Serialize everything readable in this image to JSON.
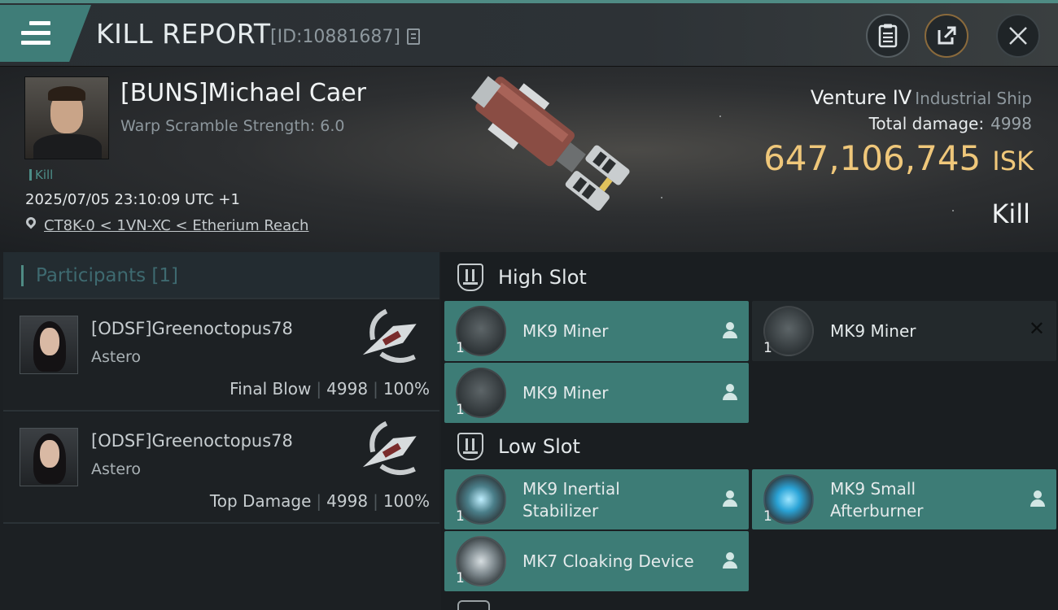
{
  "header": {
    "title": "KILL REPORT",
    "report_id": "[ID:10881687]"
  },
  "victim": {
    "name": "[BUNS]Michael Caer",
    "warp_scramble": "Warp Scramble Strength: 6.0",
    "tag": "Kill",
    "date": "2025/07/05 23:10:09 UTC +1",
    "location": "CT8K-0 < 1VN-XC < Etherium Reach"
  },
  "ship": {
    "name": "Venture IV",
    "class": "Industrial Ship",
    "total_damage_label": "Total damage:",
    "total_damage": "4998",
    "isk_value": "647,106,745",
    "isk_unit": "ISK",
    "result": "Kill"
  },
  "participants": {
    "label": "Participants [1]",
    "items": [
      {
        "name": "[ODSF]Greenoctopus78",
        "ship": "Astero",
        "role": "Final Blow",
        "damage": "4998",
        "percent": "100%"
      },
      {
        "name": "[ODSF]Greenoctopus78",
        "ship": "Astero",
        "role": "Top Damage",
        "damage": "4998",
        "percent": "100%"
      }
    ]
  },
  "high_slot": {
    "label": "High Slot",
    "modules": [
      {
        "name": "MK9 Miner",
        "qty": "1",
        "state": "destroyed"
      },
      {
        "name": "MK9 Miner",
        "qty": "1",
        "state": "dropped"
      },
      {
        "name": "MK9 Miner",
        "qty": "1",
        "state": "destroyed"
      }
    ]
  },
  "low_slot": {
    "label": "Low Slot",
    "modules": [
      {
        "name_line1": "MK9 Inertial",
        "name_line2": "Stabilizer",
        "qty": "1",
        "state": "destroyed"
      },
      {
        "name_line1": "MK9 Small",
        "name_line2": "Afterburner",
        "qty": "1",
        "state": "destroyed"
      },
      {
        "name": "MK7 Cloaking Device",
        "qty": "1",
        "state": "destroyed"
      }
    ]
  },
  "icons": {
    "menu": "menu-icon",
    "clipboard": "clipboard-icon",
    "share": "share-icon",
    "close": "close-icon",
    "copy": "copy-icon",
    "location": "location-pin-icon",
    "person": "person-icon",
    "slot": "slot-shield-icon"
  },
  "colors": {
    "accent": "#3d7c76",
    "isk": "#efc77a",
    "background": "#1a1e21"
  }
}
